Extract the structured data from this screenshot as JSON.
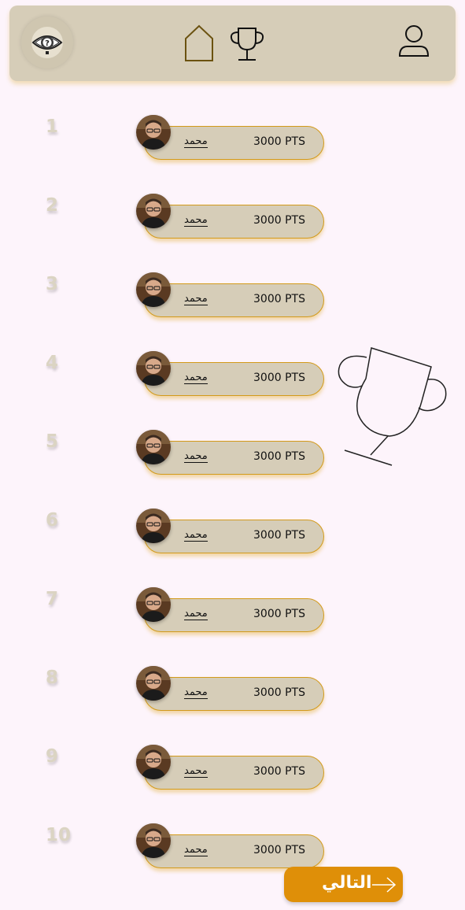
{
  "header": {
    "logo_icon": "eye-question-logo",
    "nav_icons": [
      "home-icon",
      "trophy-icon",
      "user-icon"
    ]
  },
  "leaderboard": [
    {
      "rank": "1",
      "name": "محمد",
      "points": "3000 PTS"
    },
    {
      "rank": "2",
      "name": "محمد",
      "points": "3000 PTS"
    },
    {
      "rank": "3",
      "name": "محمد",
      "points": "3000 PTS"
    },
    {
      "rank": "4",
      "name": "محمد",
      "points": "3000 PTS"
    },
    {
      "rank": "5",
      "name": "محمد",
      "points": "3000 PTS"
    },
    {
      "rank": "6",
      "name": "محمد",
      "points": "3000 PTS"
    },
    {
      "rank": "7",
      "name": "محمد",
      "points": "3000 PTS"
    },
    {
      "rank": "8",
      "name": "محمد",
      "points": "3000 PTS"
    },
    {
      "rank": "9",
      "name": "محمد",
      "points": "3000 PTS"
    },
    {
      "rank": "10",
      "name": "محمد",
      "points": "3000 PTS"
    }
  ],
  "decoration_icon": "trophy-outline-icon",
  "next_button": {
    "label": "التالي",
    "icon": "arrow-right-icon"
  },
  "colors": {
    "background": "#fdf4fb",
    "panel": "#d6cdb8",
    "accent": "#df8f08",
    "pill_border": "#d39a1a",
    "rank_text": "#dbd4c3"
  }
}
